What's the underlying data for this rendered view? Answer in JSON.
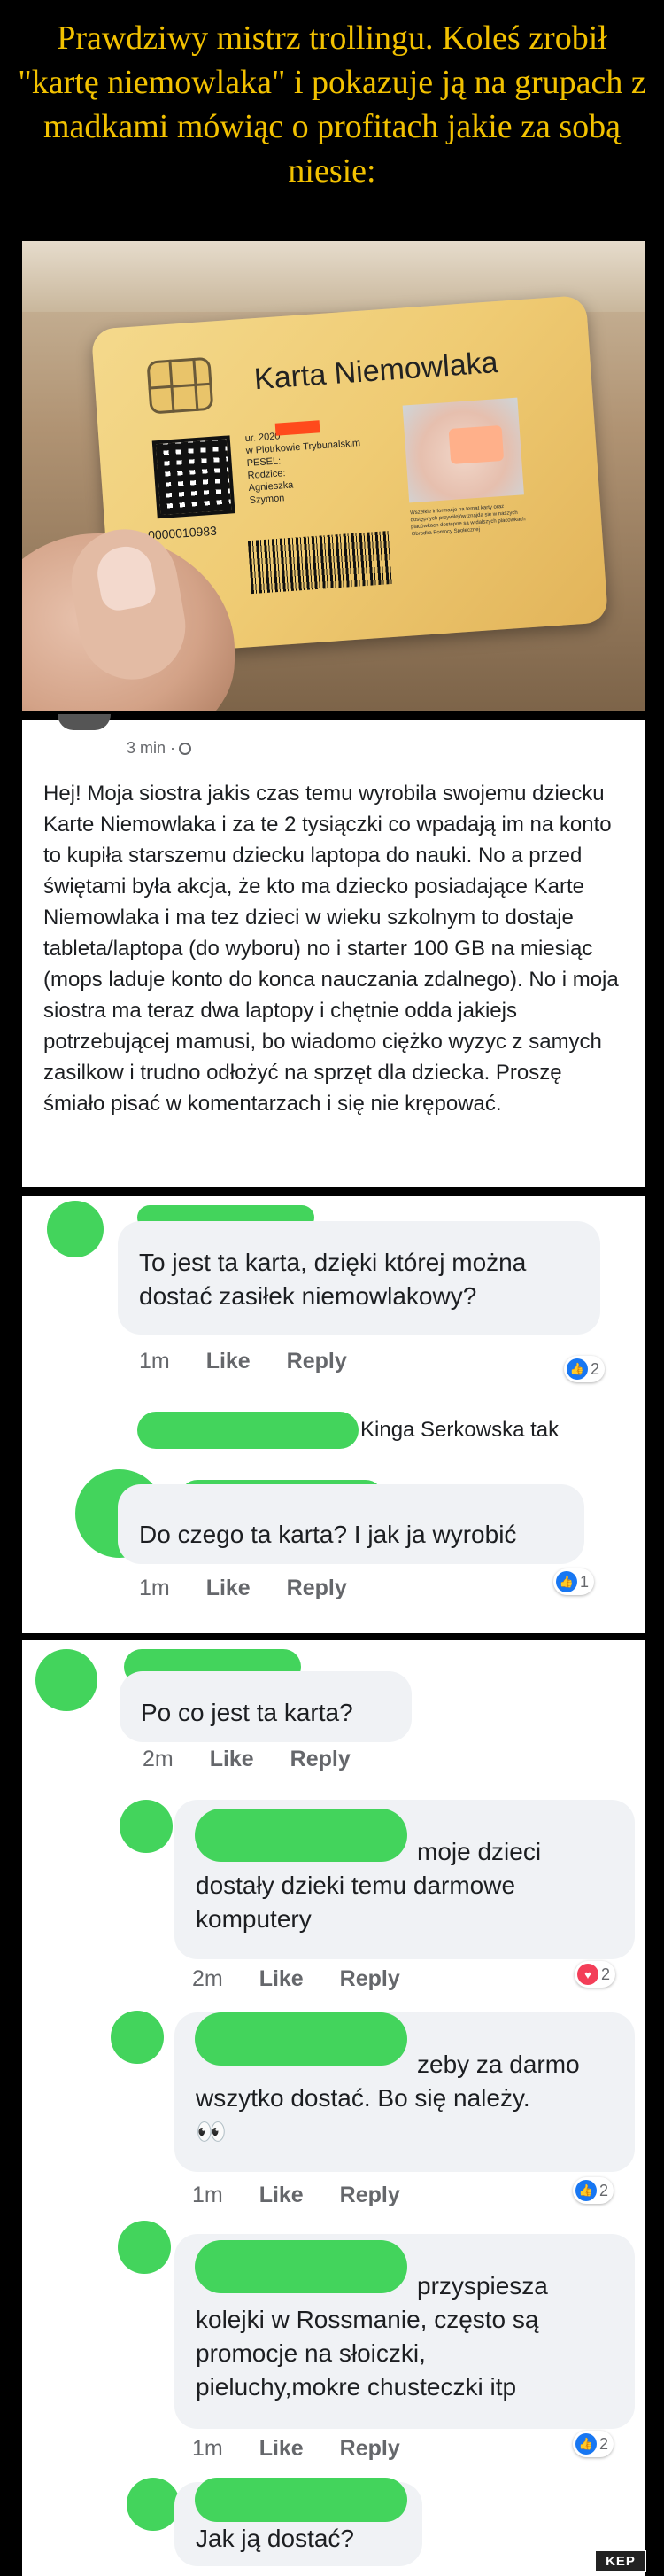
{
  "meme_title": "Prawdziwy mistrz trollingu. Koleś zrobił \"kartę niemowlaka\" i pokazuje ją na grupach z madkami mówiąc o profitach jakie za sobą niesie:",
  "card": {
    "title": "Karta Niemowlaka",
    "number": "0000010983",
    "details": [
      "ur.        2020",
      "w Piotrkowie Trybunalskim",
      "PESEL:",
      "Rodzice:",
      "Agnieszka",
      "Szymon"
    ],
    "small_text": "Wszelkie informacje na temat karty oraz dostępnych przywilejów znajdą się w naszych placówkach dostępne są w dalszych placówkach Obrodka Pomocy Społecznej"
  },
  "post": {
    "time": "3 min ·",
    "body": "Hej! Moja siostra jakis czas temu wyrobila swojemu dziecku Karte Niemowlaka i za te 2 tysiączki co wpadają im na konto to kupiła starszemu dziecku laptopa do nauki. No a przed świętami była akcja, że kto ma dziecko posiadające Karte Niemowlaka i ma tez dzieci w wieku szkolnym to dostaje tableta/laptopa (do wyboru) no i starter 100 GB na miesiąc (mops laduje konto do konca nauczania zdalnego). No i moja siostra ma teraz dwa laptopy i chętnie odda jakiejs potrzebującej mamusi, bo wiadomo ciężko wyzyc z samych zasilkow i trudno odłożyć na sprzęt dla dziecka. Proszę śmiało pisać w komentarzach i się nie krępować."
  },
  "comments1": [
    {
      "text": "To jest ta karta, dzięki której można dostać zasiłek niemowlakowy?",
      "time": "1m",
      "like": "Like",
      "reply": "Reply",
      "reactions": "2"
    },
    {
      "reply_preview": "Kinga Serkowska tak"
    },
    {
      "text": "Do czego ta karta? I jak ja wyrobić",
      "time": "1m",
      "like": "Like",
      "reply": "Reply",
      "reactions": "1"
    }
  ],
  "comments2": [
    {
      "text": "Po co jest ta karta?",
      "time": "2m",
      "like": "Like",
      "reply": "Reply"
    },
    {
      "text_lines": [
        "moje dzieci",
        "dostały dzieki temu darmowe",
        "komputery"
      ],
      "time": "2m",
      "like": "Like",
      "reply": "Reply",
      "reactions": "2"
    },
    {
      "text_lines": [
        "zeby za darmo",
        "wszytko dostać. Bo się należy.",
        "👀"
      ],
      "time": "1m",
      "like": "Like",
      "reply": "Reply",
      "reactions": "2"
    },
    {
      "text_lines": [
        "przyspiesza",
        "kolejki w Rossmanie, często są",
        "promocje na słoiczki,",
        "pieluchy,mokre chusteczki itp"
      ],
      "time": "1m",
      "like": "Like",
      "reply": "Reply",
      "reactions": "2"
    },
    {
      "text_lines": [
        "Jak ją dostać?"
      ]
    }
  ],
  "watermark": "KEP"
}
